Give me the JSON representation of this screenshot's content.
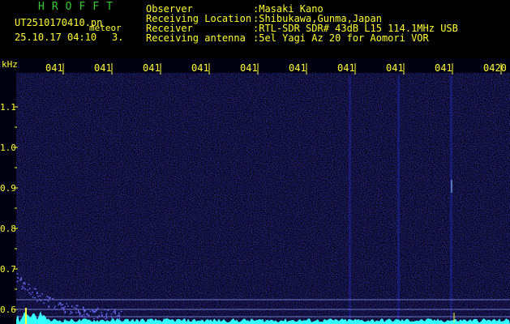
{
  "header": {
    "title": "HROFFT",
    "file_name": "UT2510170410.pn",
    "file_sub": "meteor",
    "timestamp": "25.10.17 04:10",
    "counter": "3."
  },
  "info": [
    {
      "label": "Observer",
      "value": ":Masaki Kano"
    },
    {
      "label": "Receiving Location",
      "value": ":Shibukawa,Gunma,Japan"
    },
    {
      "label": "Receiver",
      "value": ":RTL-SDR SDR# 43dB L15 114.1MHz USB"
    },
    {
      "label": "Receiving antenna",
      "value": ":5el Yagi Az 20 for Aomori VOR"
    }
  ],
  "waterfall": {
    "freq_unit": "kHz",
    "time_labels": [
      "041",
      "041",
      "041",
      "041",
      "041",
      "041",
      "041",
      "041",
      "041",
      "0420"
    ],
    "freq_labels": [
      "1.1",
      "1.0",
      "0.9",
      "0.8",
      "0.7",
      "0.6"
    ]
  },
  "colors": {
    "text": "#ffff33",
    "title": "#33cc33",
    "background": "#000000",
    "noise": "#1a1aa0",
    "signal": "#33ffff"
  }
}
